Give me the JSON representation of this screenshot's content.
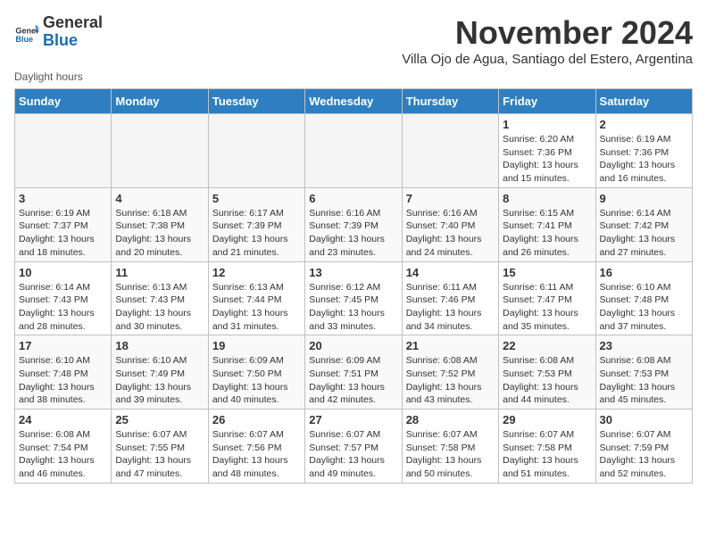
{
  "header": {
    "logo_line1": "General",
    "logo_line2": "Blue",
    "month_title": "November 2024",
    "subtitle": "Villa Ojo de Agua, Santiago del Estero, Argentina",
    "legend": "Daylight hours"
  },
  "weekdays": [
    "Sunday",
    "Monday",
    "Tuesday",
    "Wednesday",
    "Thursday",
    "Friday",
    "Saturday"
  ],
  "weeks": [
    [
      {
        "day": "",
        "info": ""
      },
      {
        "day": "",
        "info": ""
      },
      {
        "day": "",
        "info": ""
      },
      {
        "day": "",
        "info": ""
      },
      {
        "day": "",
        "info": ""
      },
      {
        "day": "1",
        "info": "Sunrise: 6:20 AM\nSunset: 7:36 PM\nDaylight: 13 hours and 15 minutes."
      },
      {
        "day": "2",
        "info": "Sunrise: 6:19 AM\nSunset: 7:36 PM\nDaylight: 13 hours and 16 minutes."
      }
    ],
    [
      {
        "day": "3",
        "info": "Sunrise: 6:19 AM\nSunset: 7:37 PM\nDaylight: 13 hours and 18 minutes."
      },
      {
        "day": "4",
        "info": "Sunrise: 6:18 AM\nSunset: 7:38 PM\nDaylight: 13 hours and 20 minutes."
      },
      {
        "day": "5",
        "info": "Sunrise: 6:17 AM\nSunset: 7:39 PM\nDaylight: 13 hours and 21 minutes."
      },
      {
        "day": "6",
        "info": "Sunrise: 6:16 AM\nSunset: 7:39 PM\nDaylight: 13 hours and 23 minutes."
      },
      {
        "day": "7",
        "info": "Sunrise: 6:16 AM\nSunset: 7:40 PM\nDaylight: 13 hours and 24 minutes."
      },
      {
        "day": "8",
        "info": "Sunrise: 6:15 AM\nSunset: 7:41 PM\nDaylight: 13 hours and 26 minutes."
      },
      {
        "day": "9",
        "info": "Sunrise: 6:14 AM\nSunset: 7:42 PM\nDaylight: 13 hours and 27 minutes."
      }
    ],
    [
      {
        "day": "10",
        "info": "Sunrise: 6:14 AM\nSunset: 7:43 PM\nDaylight: 13 hours and 28 minutes."
      },
      {
        "day": "11",
        "info": "Sunrise: 6:13 AM\nSunset: 7:43 PM\nDaylight: 13 hours and 30 minutes."
      },
      {
        "day": "12",
        "info": "Sunrise: 6:13 AM\nSunset: 7:44 PM\nDaylight: 13 hours and 31 minutes."
      },
      {
        "day": "13",
        "info": "Sunrise: 6:12 AM\nSunset: 7:45 PM\nDaylight: 13 hours and 33 minutes."
      },
      {
        "day": "14",
        "info": "Sunrise: 6:11 AM\nSunset: 7:46 PM\nDaylight: 13 hours and 34 minutes."
      },
      {
        "day": "15",
        "info": "Sunrise: 6:11 AM\nSunset: 7:47 PM\nDaylight: 13 hours and 35 minutes."
      },
      {
        "day": "16",
        "info": "Sunrise: 6:10 AM\nSunset: 7:48 PM\nDaylight: 13 hours and 37 minutes."
      }
    ],
    [
      {
        "day": "17",
        "info": "Sunrise: 6:10 AM\nSunset: 7:48 PM\nDaylight: 13 hours and 38 minutes."
      },
      {
        "day": "18",
        "info": "Sunrise: 6:10 AM\nSunset: 7:49 PM\nDaylight: 13 hours and 39 minutes."
      },
      {
        "day": "19",
        "info": "Sunrise: 6:09 AM\nSunset: 7:50 PM\nDaylight: 13 hours and 40 minutes."
      },
      {
        "day": "20",
        "info": "Sunrise: 6:09 AM\nSunset: 7:51 PM\nDaylight: 13 hours and 42 minutes."
      },
      {
        "day": "21",
        "info": "Sunrise: 6:08 AM\nSunset: 7:52 PM\nDaylight: 13 hours and 43 minutes."
      },
      {
        "day": "22",
        "info": "Sunrise: 6:08 AM\nSunset: 7:53 PM\nDaylight: 13 hours and 44 minutes."
      },
      {
        "day": "23",
        "info": "Sunrise: 6:08 AM\nSunset: 7:53 PM\nDaylight: 13 hours and 45 minutes."
      }
    ],
    [
      {
        "day": "24",
        "info": "Sunrise: 6:08 AM\nSunset: 7:54 PM\nDaylight: 13 hours and 46 minutes."
      },
      {
        "day": "25",
        "info": "Sunrise: 6:07 AM\nSunset: 7:55 PM\nDaylight: 13 hours and 47 minutes."
      },
      {
        "day": "26",
        "info": "Sunrise: 6:07 AM\nSunset: 7:56 PM\nDaylight: 13 hours and 48 minutes."
      },
      {
        "day": "27",
        "info": "Sunrise: 6:07 AM\nSunset: 7:57 PM\nDaylight: 13 hours and 49 minutes."
      },
      {
        "day": "28",
        "info": "Sunrise: 6:07 AM\nSunset: 7:58 PM\nDaylight: 13 hours and 50 minutes."
      },
      {
        "day": "29",
        "info": "Sunrise: 6:07 AM\nSunset: 7:58 PM\nDaylight: 13 hours and 51 minutes."
      },
      {
        "day": "30",
        "info": "Sunrise: 6:07 AM\nSunset: 7:59 PM\nDaylight: 13 hours and 52 minutes."
      }
    ]
  ]
}
